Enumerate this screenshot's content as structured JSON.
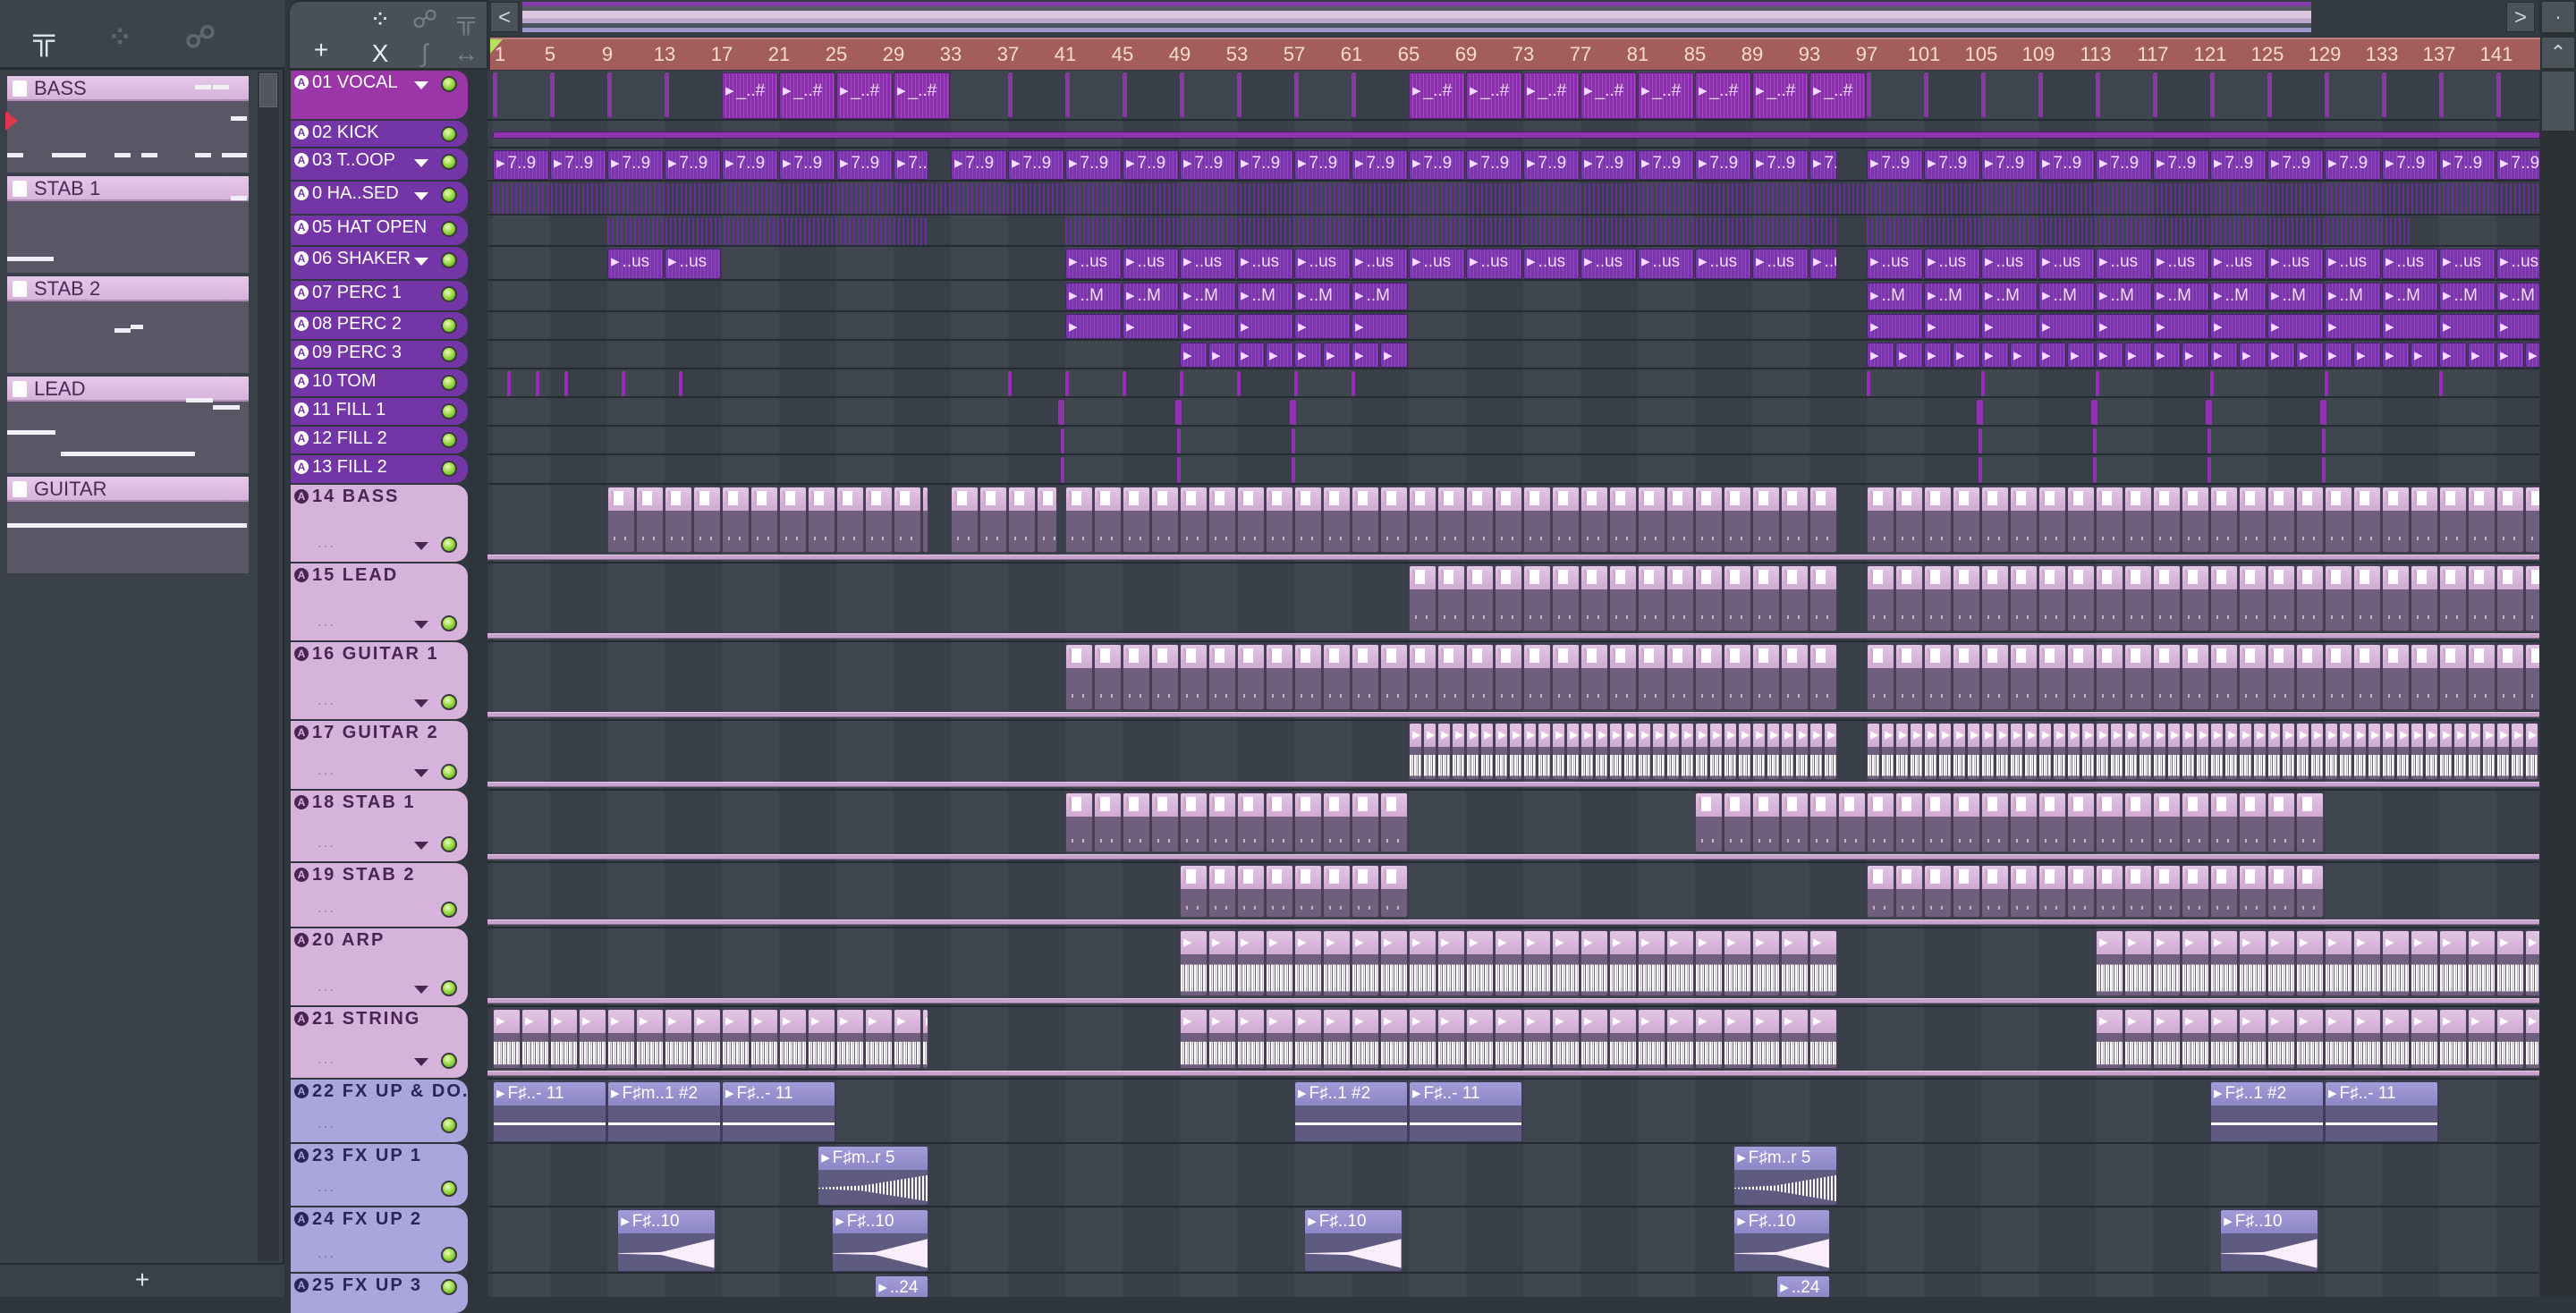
{
  "browser": {
    "tabs": [
      {
        "icon": "piano-roll-icon"
      },
      {
        "icon": "audio-wave-icon"
      },
      {
        "icon": "automation-icon"
      }
    ],
    "items": [
      {
        "label": "BASS"
      },
      {
        "label": "STAB 1"
      },
      {
        "label": "STAB 2"
      },
      {
        "label": "LEAD"
      },
      {
        "label": "GUITAR"
      }
    ],
    "add_label": "+"
  },
  "toolbar": {
    "add_label": "+",
    "tools": [
      "audio-clip-icon",
      "automation-clip-icon",
      "pattern-clip-icon",
      "x-icon",
      "curve-icon",
      "arrows-icon"
    ]
  },
  "overview": {
    "left_label": "<",
    "right_label": ">"
  },
  "ruler": {
    "labels": [
      "1",
      "5",
      "9",
      "13",
      "17",
      "21",
      "25",
      "29",
      "33",
      "37",
      "41",
      "45",
      "49",
      "53",
      "57",
      "61",
      "65",
      "69",
      "73",
      "77",
      "81",
      "85",
      "89",
      "93",
      "97",
      "101",
      "105",
      "109",
      "113",
      "117",
      "121",
      "125",
      "129",
      "133",
      "137",
      "141"
    ]
  },
  "colors": {
    "purple": "#7436a6",
    "vocal": "#9a36a8",
    "pink": "#d6b3da",
    "fx": "#aaa5dc",
    "ruler": "#a25d5c",
    "led": "#8fd33a"
  },
  "tracks": [
    {
      "name": "01 VOCAL",
      "type": "vocal",
      "menu": true,
      "clips": [
        [
          17,
          33,
          4,
          "_..#",
          "voc"
        ],
        [
          65,
          97,
          4,
          "_..#",
          "voc"
        ]
      ]
    },
    {
      "name": "02 KICK",
      "type": "purple",
      "menu": false,
      "clips": [
        [
          1,
          144.5,
          143.5,
          "",
          "line"
        ]
      ]
    },
    {
      "name": "03 T..OOP",
      "type": "purple",
      "menu": true,
      "clips": [
        [
          1,
          31.5,
          4,
          "7..9",
          "aud"
        ],
        [
          33,
          95,
          4,
          "7..9",
          "aud"
        ],
        [
          97,
          144.5,
          4,
          "7..9",
          "aud"
        ]
      ]
    },
    {
      "name": "0 HA..SED",
      "type": "purple",
      "menu": true,
      "clips": [
        [
          1,
          144.5,
          143.5,
          "",
          "stripe"
        ]
      ]
    },
    {
      "name": "05 HAT OPEN",
      "type": "purple",
      "menu": false,
      "clips": [
        [
          9,
          31.5,
          22.5,
          "",
          "stripe"
        ],
        [
          41,
          95,
          54,
          "",
          "stripe"
        ],
        [
          97,
          135,
          38,
          "",
          "stripe"
        ]
      ]
    },
    {
      "name": "06 SHAKER",
      "type": "purple",
      "menu": true,
      "clips": [
        [
          9,
          17,
          4,
          "..us",
          "aud"
        ],
        [
          41,
          95,
          4,
          "..us",
          "aud"
        ],
        [
          97,
          144.5,
          4,
          "..us",
          "aud"
        ]
      ]
    },
    {
      "name": "07 PERC 1",
      "type": "purple",
      "menu": false,
      "clips": [
        [
          41,
          65,
          4,
          "..M",
          "aud"
        ],
        [
          97,
          144.5,
          4,
          "..M",
          "aud"
        ]
      ]
    },
    {
      "name": "08 PERC 2",
      "type": "purple",
      "menu": false,
      "clips": [
        [
          41,
          65,
          4,
          "",
          "aud"
        ],
        [
          97,
          144.5,
          4,
          "",
          "aud"
        ]
      ]
    },
    {
      "name": "09 PERC 3",
      "type": "purple",
      "menu": false,
      "clips": [
        [
          49,
          65,
          2,
          "",
          "aud"
        ],
        [
          97,
          144.5,
          2,
          "",
          "aud"
        ]
      ]
    },
    {
      "name": "10 TOM",
      "type": "purple",
      "menu": false,
      "clips": [
        [
          2,
          2.3,
          1,
          "",
          "mark"
        ],
        [
          4,
          4.3,
          1,
          "",
          "mark"
        ],
        [
          6,
          6.3,
          1,
          "",
          "mark"
        ],
        [
          10,
          10.3,
          1,
          "",
          "mark"
        ],
        [
          14,
          14.3,
          1,
          "",
          "mark"
        ],
        [
          37,
          37.3,
          1,
          "",
          "mark"
        ],
        [
          41,
          41.3,
          1,
          "",
          "mark"
        ],
        [
          45,
          45.3,
          1,
          "",
          "mark"
        ],
        [
          49,
          49.3,
          1,
          "",
          "mark"
        ],
        [
          53,
          53.3,
          1,
          "",
          "mark"
        ],
        [
          57,
          57.3,
          1,
          "",
          "mark"
        ],
        [
          61,
          61.3,
          1,
          "",
          "mark"
        ],
        [
          97,
          97.3,
          1,
          "",
          "mark"
        ],
        [
          105,
          105.3,
          1,
          "",
          "mark"
        ],
        [
          113,
          113.3,
          1,
          "",
          "mark"
        ],
        [
          121,
          121.3,
          1,
          "",
          "mark"
        ],
        [
          129,
          129.3,
          1,
          "",
          "mark"
        ],
        [
          137,
          137.3,
          1,
          "",
          "mark"
        ],
        [
          144,
          144.3,
          1,
          "",
          "mark"
        ]
      ]
    },
    {
      "name": "11 FILL 1",
      "type": "purple",
      "menu": false,
      "clips": [
        [
          40.5,
          41,
          1,
          "",
          "mark"
        ],
        [
          48.7,
          49.2,
          1,
          "",
          "mark"
        ],
        [
          56.7,
          57.2,
          1,
          "",
          "mark"
        ],
        [
          104.7,
          105.2,
          1,
          "",
          "mark"
        ],
        [
          112.7,
          113.2,
          1,
          "",
          "mark"
        ],
        [
          120.7,
          121.2,
          1,
          "",
          "mark"
        ],
        [
          128.7,
          129.2,
          1,
          "",
          "mark"
        ]
      ]
    },
    {
      "name": "12 FILL 2",
      "type": "purple",
      "menu": false,
      "clips": [
        [
          40.7,
          41,
          1,
          "",
          "mark"
        ],
        [
          48.8,
          49.1,
          1,
          "",
          "mark"
        ],
        [
          56.8,
          57.1,
          1,
          "",
          "mark"
        ],
        [
          104.8,
          105.1,
          1,
          "",
          "mark"
        ],
        [
          112.8,
          113.1,
          1,
          "",
          "mark"
        ],
        [
          120.8,
          121.1,
          1,
          "",
          "mark"
        ],
        [
          128.8,
          129.1,
          1,
          "",
          "mark"
        ]
      ]
    },
    {
      "name": "13 FILL 2",
      "type": "purple",
      "menu": false,
      "clips": [
        [
          40.7,
          41,
          1,
          "",
          "mark"
        ],
        [
          48.8,
          49.1,
          1,
          "",
          "mark"
        ],
        [
          56.8,
          57.1,
          1,
          "",
          "mark"
        ],
        [
          104.8,
          105.1,
          1,
          "",
          "mark"
        ],
        [
          112.8,
          113.1,
          1,
          "",
          "mark"
        ],
        [
          120.8,
          121.1,
          1,
          "",
          "mark"
        ],
        [
          128.8,
          129.1,
          1,
          "",
          "mark"
        ]
      ]
    },
    {
      "name": "14 BASS",
      "type": "pink",
      "menu": true,
      "clips": [
        [
          9,
          31.5,
          2,
          "",
          "pat"
        ],
        [
          33,
          40.5,
          2,
          "",
          "pat"
        ],
        [
          41,
          95,
          2,
          "",
          "pat"
        ],
        [
          97,
          144.5,
          2,
          "",
          "pat"
        ]
      ]
    },
    {
      "name": "15 LEAD",
      "type": "pink",
      "menu": true,
      "clips": [
        [
          65,
          95,
          2,
          "",
          "pat"
        ],
        [
          97,
          144.5,
          2,
          "",
          "pat"
        ]
      ]
    },
    {
      "name": "16 GUITAR 1",
      "type": "pink",
      "menu": true,
      "clips": [
        [
          41,
          95,
          2,
          "",
          "pat"
        ],
        [
          97,
          144.5,
          2,
          "",
          "pat"
        ]
      ]
    },
    {
      "name": "17 GUITAR 2",
      "type": "pink",
      "menu": true,
      "clips": [
        [
          65,
          95,
          1,
          "",
          "wav"
        ],
        [
          97,
          144.5,
          1,
          "",
          "wav"
        ]
      ]
    },
    {
      "name": "18 STAB 1",
      "type": "pink",
      "menu": true,
      "clips": [
        [
          41,
          65,
          2,
          "",
          "pat"
        ],
        [
          85,
          129,
          2,
          "",
          "pat"
        ]
      ]
    },
    {
      "name": "19 STAB 2",
      "type": "pink",
      "menu": false,
      "clips": [
        [
          49,
          65,
          2,
          "",
          "pat"
        ],
        [
          97,
          129,
          2,
          "",
          "pat"
        ]
      ]
    },
    {
      "name": "20 ARP",
      "type": "pink",
      "menu": true,
      "clips": [
        [
          49,
          95,
          2,
          "",
          "wav"
        ],
        [
          113,
          144.5,
          2,
          "",
          "wav"
        ]
      ]
    },
    {
      "name": "21 STRING",
      "type": "pink",
      "menu": true,
      "clips": [
        [
          1,
          31.5,
          2,
          "",
          "wav"
        ],
        [
          49,
          95,
          2,
          "",
          "wav"
        ],
        [
          113,
          144.5,
          2,
          "",
          "wav"
        ]
      ]
    },
    {
      "name": "22 FX UP & DO..",
      "type": "fx",
      "menu": false,
      "clips": [
        [
          1,
          9,
          8,
          "F♯..- 11",
          "swell"
        ],
        [
          9,
          17,
          8,
          "F♯m..1 #2",
          "swell"
        ],
        [
          17,
          25,
          8,
          "F♯..- 11",
          "swell"
        ],
        [
          57,
          65,
          8,
          "F♯..1 #2",
          "swell"
        ],
        [
          65,
          73,
          8,
          "F♯..- 11",
          "swell"
        ],
        [
          121,
          129,
          8,
          "F♯..1 #2",
          "swell"
        ],
        [
          129,
          137,
          8,
          "F♯..- 11",
          "swell"
        ]
      ]
    },
    {
      "name": "23 FX UP 1",
      "type": "fx",
      "menu": false,
      "clips": [
        [
          23.7,
          31.5,
          7.8,
          "F♯m..r 5",
          "burst"
        ],
        [
          87.7,
          95,
          7.3,
          "F♯m..r 5",
          "burst"
        ]
      ]
    },
    {
      "name": "24 FX UP 2",
      "type": "fx",
      "menu": false,
      "clips": [
        [
          9.7,
          16.6,
          6.9,
          "F♯..10",
          "riser"
        ],
        [
          24.7,
          31.5,
          6.8,
          "F♯..10",
          "riser"
        ],
        [
          57.7,
          64.6,
          6.9,
          "F♯..10",
          "riser"
        ],
        [
          87.7,
          94.5,
          6.8,
          "F♯..10",
          "riser"
        ],
        [
          121.7,
          128.6,
          6.9,
          "F♯..10",
          "riser"
        ]
      ]
    },
    {
      "name": "25 FX UP 3",
      "type": "fx",
      "menu": false,
      "clips": [
        [
          27.7,
          31.5,
          3.8,
          "..24",
          "riser"
        ],
        [
          90.7,
          94.5,
          3.8,
          "..24",
          "riser"
        ]
      ]
    }
  ]
}
